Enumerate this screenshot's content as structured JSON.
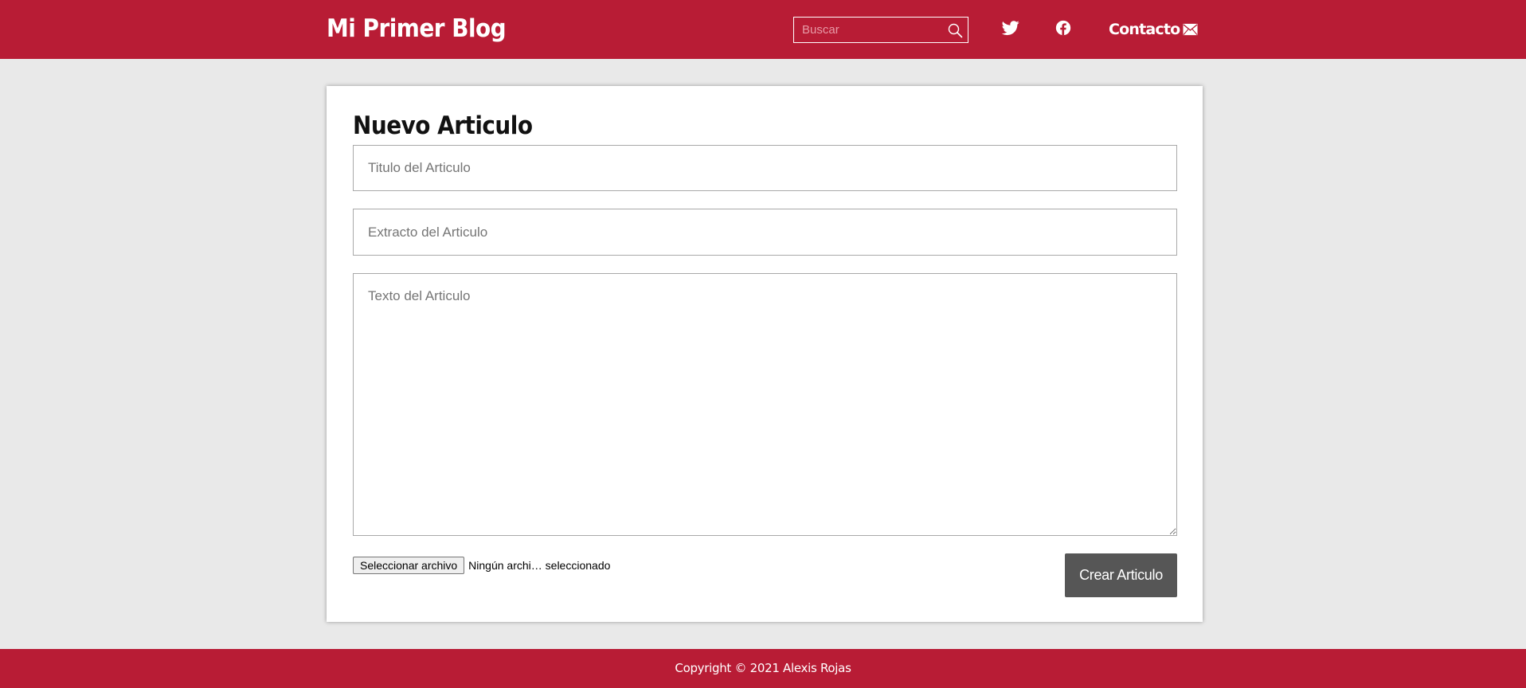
{
  "header": {
    "brand": "Mi Primer Blog",
    "search": {
      "placeholder": "Buscar",
      "value": "",
      "icon": "search-icon"
    },
    "social_icons": [
      "twitter-icon",
      "facebook-icon"
    ],
    "contact": {
      "label": "Contacto",
      "icon": "mail-icon"
    }
  },
  "form": {
    "heading": "Nuevo Articulo",
    "title_field": {
      "placeholder": "Titulo del Articulo",
      "value": ""
    },
    "excerpt_field": {
      "placeholder": "Extracto del Articulo",
      "value": ""
    },
    "body_field": {
      "placeholder": "Texto del Articulo",
      "value": ""
    },
    "file": {
      "button_label": "Seleccionar archivo",
      "status": "Ningún archi… seleccionado"
    },
    "submit_label": "Crear Articulo"
  },
  "footer": {
    "copyright": "Copyright © 2021 Alexis Rojas"
  },
  "colors": {
    "brand_red": "#b81c35",
    "page_background": "#e9e9e9",
    "button_gray": "#565656"
  }
}
